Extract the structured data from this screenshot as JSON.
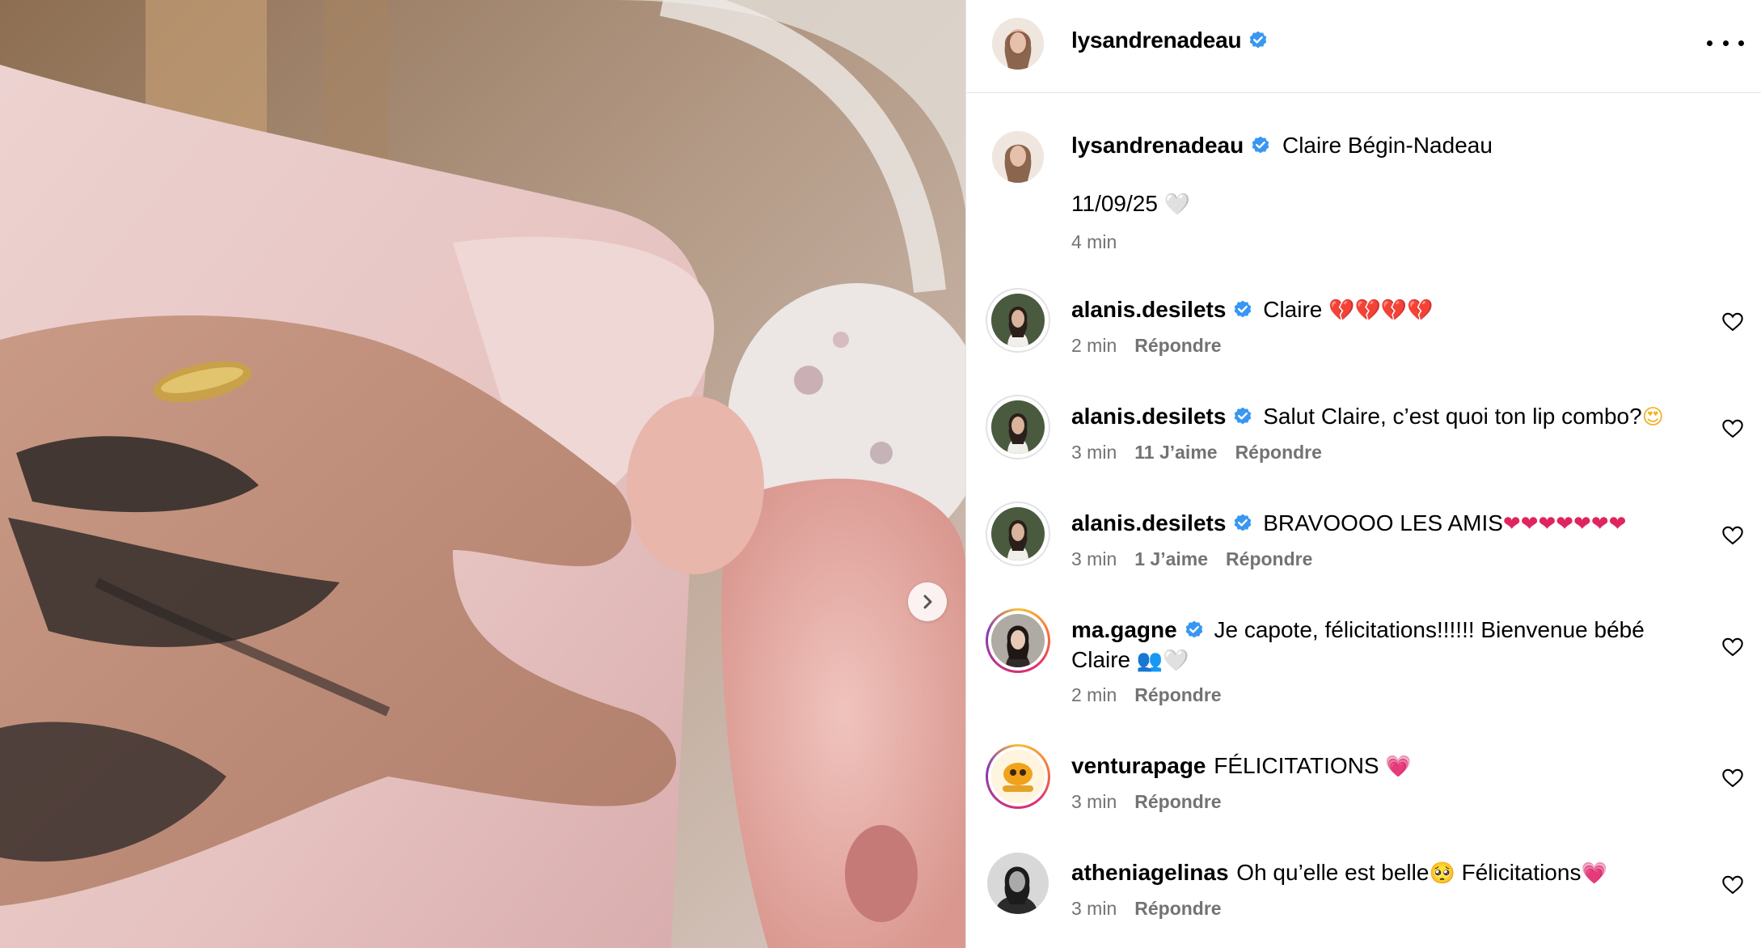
{
  "header": {
    "username": "lysandrenadeau",
    "verified": true,
    "more_icon": "more-horizontal-icon"
  },
  "media": {
    "next_icon": "chevron-right-icon",
    "description_icons": [
      "tattooed-hand",
      "newborn-baby",
      "pink-blanket",
      "gold-ring"
    ]
  },
  "caption": {
    "username": "lysandrenadeau",
    "text": "Claire Bégin-Nadeau",
    "date_line": "11/09/25",
    "date_emoji": "🤍",
    "time": "4 min"
  },
  "comments": [
    {
      "username": "alanis.desilets",
      "verified": true,
      "text": "Claire",
      "emoji": "💔💔💔💔",
      "time": "2 min",
      "likes": "",
      "reply": "Répondre",
      "avatar_style": "plain-ring"
    },
    {
      "username": "alanis.desilets",
      "verified": true,
      "text": "Salut Claire, c’est quoi ton lip combo?",
      "emoji": "😍",
      "time": "3 min",
      "likes": "11 J’aime",
      "reply": "Répondre",
      "avatar_style": "plain-ring"
    },
    {
      "username": "alanis.desilets",
      "verified": true,
      "text": "BRAVOOOO LES AMIS",
      "emoji": "❤❤❤❤❤❤❤",
      "time": "3 min",
      "likes": "1 J’aime",
      "reply": "Répondre",
      "avatar_style": "plain-ring"
    },
    {
      "username": "ma.gagne",
      "verified": true,
      "text": "Je capote, félicitations!!!!!! Bienvenue bébé Claire",
      "emoji": "👥🤍",
      "time": "2 min",
      "likes": "",
      "reply": "Répondre",
      "avatar_style": "story-ring"
    },
    {
      "username": "venturapage",
      "verified": false,
      "text": "FÉLICITATIONS",
      "emoji": "💗",
      "time": "3 min",
      "likes": "",
      "reply": "Répondre",
      "avatar_style": "story-ring"
    },
    {
      "username": "atheniagelinas",
      "verified": false,
      "text": "Oh qu’elle est belle",
      "emoji": "🥺",
      "text2": "Félicitations",
      "emoji2": "💗",
      "time": "3 min",
      "likes": "",
      "reply": "Répondre",
      "avatar_style": "none"
    }
  ],
  "colors": {
    "verified": "#3897f0",
    "secondary_text": "#737373",
    "divider": "#e6e6e6"
  }
}
